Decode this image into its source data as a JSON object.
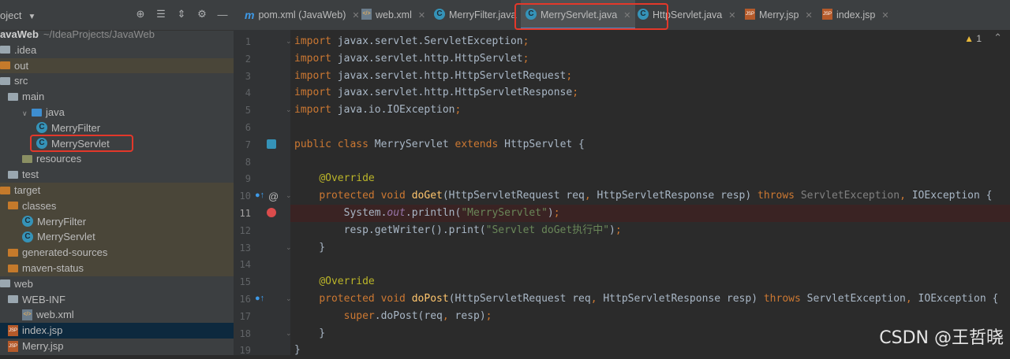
{
  "project_panel": {
    "title": "oject",
    "tools": [
      "crosshair-icon",
      "collapse-icon",
      "expand-icon",
      "gear-icon",
      "minimize-icon"
    ],
    "tree": [
      {
        "label": "avaWeb",
        "extra": "~/IdeaProjects/JavaWeb",
        "icon": "none",
        "depth": 0,
        "bold": true
      },
      {
        "label": ".idea",
        "icon": "folder-grey",
        "depth": 0
      },
      {
        "label": "out",
        "icon": "folder-orange",
        "depth": 0,
        "highlight": true
      },
      {
        "label": "src",
        "icon": "folder-grey",
        "depth": 0
      },
      {
        "label": "main",
        "icon": "folder-grey",
        "depth": 1
      },
      {
        "label": "java",
        "icon": "folder-blue",
        "depth": 2,
        "arrow": "open"
      },
      {
        "label": "MerryFilter",
        "icon": "class",
        "depth": 3
      },
      {
        "label": "MerryServlet",
        "icon": "class",
        "depth": 3,
        "boxed": true
      },
      {
        "label": "resources",
        "icon": "folder-res",
        "depth": 2
      },
      {
        "label": "test",
        "icon": "folder-grey",
        "depth": 1
      },
      {
        "label": "target",
        "icon": "folder-orange",
        "depth": 0,
        "highlight": true
      },
      {
        "label": "classes",
        "icon": "folder-orange",
        "depth": 1,
        "highlight": true
      },
      {
        "label": "MerryFilter",
        "icon": "class",
        "depth": 2,
        "highlight": true
      },
      {
        "label": "MerryServlet",
        "icon": "class",
        "depth": 2,
        "highlight": true
      },
      {
        "label": "generated-sources",
        "icon": "folder-orange",
        "depth": 1,
        "highlight": true
      },
      {
        "label": "maven-status",
        "icon": "folder-orange",
        "depth": 1,
        "highlight": true
      },
      {
        "label": "web",
        "icon": "folder-grey",
        "depth": 0
      },
      {
        "label": "WEB-INF",
        "icon": "folder-grey",
        "depth": 1
      },
      {
        "label": "web.xml",
        "icon": "xml",
        "depth": 2
      },
      {
        "label": "index.jsp",
        "icon": "jsp",
        "depth": 1,
        "selected": true
      },
      {
        "label": "Merry.jsp",
        "icon": "jsp",
        "depth": 1
      }
    ]
  },
  "tabs": [
    {
      "label": "pom.xml (JavaWeb)",
      "icon": "m"
    },
    {
      "label": "web.xml",
      "icon": "xml"
    },
    {
      "label": "MerryFilter.java",
      "icon": "class"
    },
    {
      "label": "MerryServlet.java",
      "icon": "class",
      "active": true
    },
    {
      "label": "HttpServlet.java",
      "icon": "class-lock"
    },
    {
      "label": "Merry.jsp",
      "icon": "jsp"
    },
    {
      "label": "index.jsp",
      "icon": "jsp"
    }
  ],
  "editor": {
    "warnings": "1",
    "current_line": 11,
    "line_numbers": [
      "1",
      "2",
      "3",
      "4",
      "5",
      "6",
      "7",
      "8",
      "9",
      "10",
      "11",
      "12",
      "13",
      "14",
      "15",
      "16",
      "17",
      "18",
      "19"
    ],
    "lines": [
      [
        {
          "t": "kw",
          "v": "import"
        },
        {
          "t": "p",
          "v": " javax.servlet.ServletException"
        },
        {
          "t": "kw",
          "v": ";"
        }
      ],
      [
        {
          "t": "kw",
          "v": "import"
        },
        {
          "t": "p",
          "v": " javax.servlet.http.HttpServlet"
        },
        {
          "t": "kw",
          "v": ";"
        }
      ],
      [
        {
          "t": "kw",
          "v": "import"
        },
        {
          "t": "p",
          "v": " javax.servlet.http.HttpServletRequest"
        },
        {
          "t": "kw",
          "v": ";"
        }
      ],
      [
        {
          "t": "kw",
          "v": "import"
        },
        {
          "t": "p",
          "v": " javax.servlet.http.HttpServletResponse"
        },
        {
          "t": "kw",
          "v": ";"
        }
      ],
      [
        {
          "t": "kw",
          "v": "import"
        },
        {
          "t": "p",
          "v": " java.io.IOException"
        },
        {
          "t": "kw",
          "v": ";"
        }
      ],
      [],
      [
        {
          "t": "kw",
          "v": "public class "
        },
        {
          "t": "p",
          "v": "MerryServlet "
        },
        {
          "t": "kw",
          "v": "extends "
        },
        {
          "t": "p",
          "v": "HttpServlet {"
        }
      ],
      [],
      [
        {
          "t": "p",
          "v": "    "
        },
        {
          "t": "ann",
          "v": "@Override"
        }
      ],
      [
        {
          "t": "p",
          "v": "    "
        },
        {
          "t": "kw",
          "v": "protected void "
        },
        {
          "t": "fn",
          "v": "doGet"
        },
        {
          "t": "p",
          "v": "(HttpServletRequest req"
        },
        {
          "t": "kw",
          "v": ", "
        },
        {
          "t": "p",
          "v": "HttpServletResponse resp) "
        },
        {
          "t": "kw",
          "v": "throws "
        },
        {
          "t": "gray",
          "v": "ServletException"
        },
        {
          "t": "kw",
          "v": ", "
        },
        {
          "t": "p",
          "v": "IOException {"
        }
      ],
      [
        {
          "t": "p",
          "v": "        System."
        },
        {
          "t": "st",
          "v": "out"
        },
        {
          "t": "p",
          "v": ".println("
        },
        {
          "t": "str",
          "v": "\"MerryServlet\""
        },
        {
          "t": "p",
          "v": ")"
        },
        {
          "t": "kw",
          "v": ";"
        }
      ],
      [
        {
          "t": "p",
          "v": "        resp.getWriter().print("
        },
        {
          "t": "str",
          "v": "\"Servlet doGet执行中\""
        },
        {
          "t": "p",
          "v": ")"
        },
        {
          "t": "kw",
          "v": ";"
        }
      ],
      [
        {
          "t": "p",
          "v": "    }"
        }
      ],
      [],
      [
        {
          "t": "p",
          "v": "    "
        },
        {
          "t": "ann",
          "v": "@Override"
        }
      ],
      [
        {
          "t": "p",
          "v": "    "
        },
        {
          "t": "kw",
          "v": "protected void "
        },
        {
          "t": "fn",
          "v": "doPost"
        },
        {
          "t": "p",
          "v": "(HttpServletRequest req"
        },
        {
          "t": "kw",
          "v": ", "
        },
        {
          "t": "p",
          "v": "HttpServletResponse resp) "
        },
        {
          "t": "kw",
          "v": "throws "
        },
        {
          "t": "p",
          "v": "ServletException"
        },
        {
          "t": "kw",
          "v": ", "
        },
        {
          "t": "p",
          "v": "IOException {"
        }
      ],
      [
        {
          "t": "p",
          "v": "        "
        },
        {
          "t": "kw",
          "v": "super"
        },
        {
          "t": "p",
          "v": ".doPost(req"
        },
        {
          "t": "kw",
          "v": ", "
        },
        {
          "t": "p",
          "v": "resp)"
        },
        {
          "t": "kw",
          "v": ";"
        }
      ],
      [
        {
          "t": "p",
          "v": "    }"
        }
      ],
      [
        {
          "t": "p",
          "v": "}"
        }
      ]
    ]
  },
  "watermark": "CSDN @王哲晓",
  "colors": {
    "accent": "#4a88c7",
    "annotation_box": "#e3382a"
  }
}
